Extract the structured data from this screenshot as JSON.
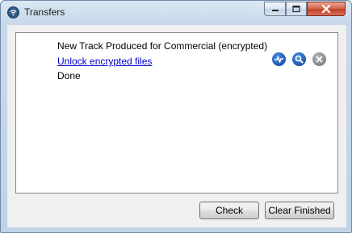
{
  "window": {
    "title": "Transfers",
    "app_icon": "wifi-icon"
  },
  "caption_buttons": {
    "minimize_icon": "minimize-icon",
    "maximize_icon": "maximize-icon",
    "close_icon": "close-icon"
  },
  "transfer": {
    "name": "New Track Produced for Commercial (encrypted)",
    "link": "Unlock encrypted files",
    "status": "Done",
    "actions": [
      "play-icon",
      "search-icon",
      "remove-icon"
    ]
  },
  "buttons": {
    "check": "Check",
    "clear_finished": "Clear Finished"
  },
  "colors": {
    "link": "#0000cc",
    "action_blue": "#0b3f9a",
    "action_grey": "#6f6f6f",
    "close_red": "#c3422a"
  }
}
